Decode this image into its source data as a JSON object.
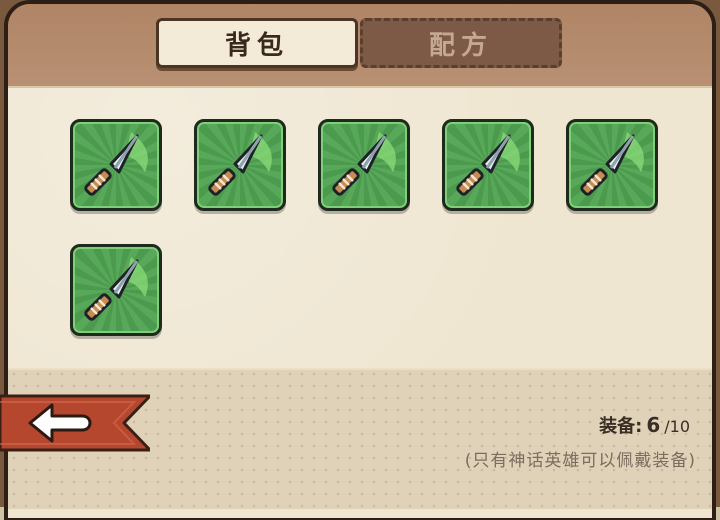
{
  "tabs": [
    {
      "label": "背包",
      "active": true
    },
    {
      "label": "配方",
      "active": false
    }
  ],
  "inventory": {
    "items": [
      {
        "icon": "spear-icon"
      },
      {
        "icon": "spear-icon"
      },
      {
        "icon": "spear-icon"
      },
      {
        "icon": "spear-icon"
      },
      {
        "icon": "spear-icon"
      },
      {
        "icon": "spear-icon"
      }
    ]
  },
  "footer": {
    "equip_label": "装备:",
    "equip_count": "6",
    "equip_max": "/10",
    "note": "(只有神话英雄可以佩戴装备)"
  },
  "back_button": {
    "icon": "arrow-left-icon"
  },
  "colors": {
    "slot_green": "#58a85a",
    "panel_bg": "#efe6d1",
    "frame_brown": "#a87f5f",
    "banner_red": "#b5472e"
  }
}
